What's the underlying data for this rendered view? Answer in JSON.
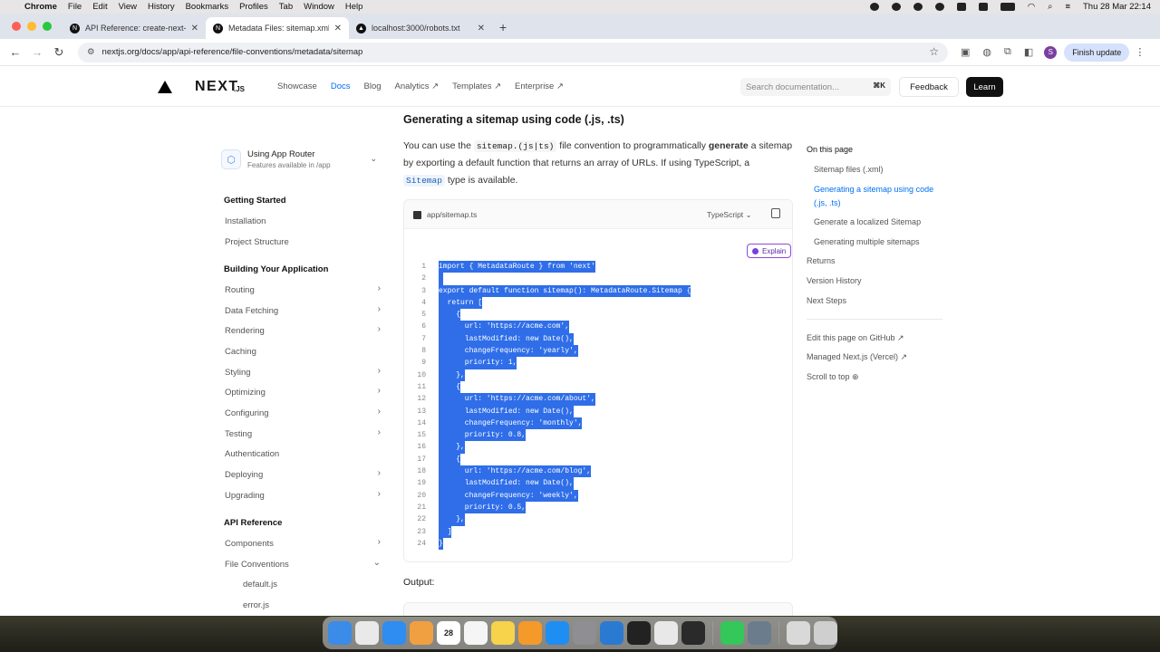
{
  "menubar": {
    "apple": "",
    "app": "Chrome",
    "items": [
      "File",
      "Edit",
      "View",
      "History",
      "Bookmarks",
      "Profiles",
      "Tab",
      "Window",
      "Help"
    ],
    "datetime": "Thu 28 Mar  22:14"
  },
  "tabs": [
    {
      "title": "API Reference: create-next-a",
      "icon": "N",
      "active": false
    },
    {
      "title": "Metadata Files: sitemap.xml |",
      "icon": "N",
      "active": true
    },
    {
      "title": "localhost:3000/robots.txt",
      "icon": "▲",
      "active": false
    }
  ],
  "address": {
    "url": "nextjs.org/docs/app/api-reference/file-conventions/metadata/sitemap",
    "profile_initial": "S",
    "finish_update": "Finish update"
  },
  "site_header": {
    "logo_text": "NEXT",
    "logo_suffix": ".JS",
    "nav": [
      "Showcase",
      "Docs",
      "Blog",
      "Analytics ↗",
      "Templates ↗",
      "Enterprise ↗"
    ],
    "search_placeholder": "Search documentation...",
    "search_kbd": "⌘K",
    "feedback": "Feedback",
    "learn": "Learn"
  },
  "router_selector": {
    "title": "Using App Router",
    "subtitle": "Features available in /app"
  },
  "sidebar": {
    "sections": [
      {
        "heading": "Getting Started",
        "items": [
          {
            "label": "Installation",
            "chevron": false
          },
          {
            "label": "Project Structure",
            "chevron": false
          }
        ]
      },
      {
        "heading": "Building Your Application",
        "items": [
          {
            "label": "Routing",
            "chevron": true
          },
          {
            "label": "Data Fetching",
            "chevron": true
          },
          {
            "label": "Rendering",
            "chevron": true
          },
          {
            "label": "Caching",
            "chevron": false
          },
          {
            "label": "Styling",
            "chevron": true
          },
          {
            "label": "Optimizing",
            "chevron": true
          },
          {
            "label": "Configuring",
            "chevron": true
          },
          {
            "label": "Testing",
            "chevron": true
          },
          {
            "label": "Authentication",
            "chevron": false
          },
          {
            "label": "Deploying",
            "chevron": true
          },
          {
            "label": "Upgrading",
            "chevron": true
          }
        ]
      },
      {
        "heading": "API Reference",
        "items": [
          {
            "label": "Components",
            "chevron": true
          },
          {
            "label": "File Conventions",
            "chevron": true
          }
        ]
      }
    ],
    "sub_items": [
      "default.js",
      "error.js"
    ]
  },
  "article": {
    "heading": "Generating a sitemap using code (.js, .ts)",
    "p_before_code": "You can use the",
    "code1": "sitemap.(js|ts)",
    "p_mid1": "file convention to programmatically",
    "bold": "generate",
    "p_mid2": "a sitemap by exporting a default function that returns an array of URLs. If using TypeScript, a",
    "code2": "Sitemap",
    "p_after": "type is available.",
    "output_label": "Output:"
  },
  "code_block": {
    "filename": "app/sitemap.ts",
    "language": "TypeScript",
    "explain": "Explain",
    "lines": [
      "import { MetadataRoute } from 'next'",
      " ",
      "export default function sitemap(): MetadataRoute.Sitemap {",
      "  return [",
      "    {",
      "      url: 'https://acme.com',",
      "      lastModified: new Date(),",
      "      changeFrequency: 'yearly',",
      "      priority: 1,",
      "    },",
      "    {",
      "      url: 'https://acme.com/about',",
      "      lastModified: new Date(),",
      "      changeFrequency: 'monthly',",
      "      priority: 0.8,",
      "    },",
      "    {",
      "      url: 'https://acme.com/blog',",
      "      lastModified: new Date(),",
      "      changeFrequency: 'weekly',",
      "      priority: 0.5,",
      "    },",
      "  ]",
      "}"
    ]
  },
  "toc": {
    "heading": "On this page",
    "items": [
      {
        "label": "Sitemap files (.xml)",
        "active": false,
        "indent": true
      },
      {
        "label": "Generating a sitemap using code (.js, .ts)",
        "active": true,
        "indent": true
      },
      {
        "label": "Generate a localized Sitemap",
        "active": false,
        "indent": true
      },
      {
        "label": "Generating multiple sitemaps",
        "active": false,
        "indent": true
      },
      {
        "label": "Returns",
        "active": false,
        "indent": false
      },
      {
        "label": "Version History",
        "active": false,
        "indent": false
      },
      {
        "label": "Next Steps",
        "active": false,
        "indent": false
      }
    ],
    "links": [
      "Edit this page on GitHub ↗",
      "Managed Next.js (Vercel) ↗",
      "Scroll to top ⊕"
    ]
  },
  "dock": {
    "apps": [
      {
        "name": "finder-icon",
        "color": "#3b8be8"
      },
      {
        "name": "launchpad-icon",
        "color": "#e9e9e9"
      },
      {
        "name": "safari-icon",
        "color": "#2f8cf0"
      },
      {
        "name": "photos-icon",
        "color": "#f0a040"
      },
      {
        "name": "calendar-icon",
        "color": "#ffffff",
        "text": "28"
      },
      {
        "name": "reminders-icon",
        "color": "#f5f5f5"
      },
      {
        "name": "notes-icon",
        "color": "#f7d24b"
      },
      {
        "name": "pages-icon",
        "color": "#f39a2a"
      },
      {
        "name": "app-store-icon",
        "color": "#1e8ef3"
      },
      {
        "name": "system-settings-icon",
        "color": "#8e8e93"
      },
      {
        "name": "vscode-icon",
        "color": "#2a7ad2"
      },
      {
        "name": "terminal-icon",
        "color": "#222222"
      },
      {
        "name": "chrome-icon",
        "color": "#e8e8e8"
      },
      {
        "name": "activity-monitor-icon",
        "color": "#2a2a2a"
      },
      {
        "name": "numbers-icon",
        "color": "#34c759"
      },
      {
        "name": "disk-utility-icon",
        "color": "#6b7d8c"
      },
      {
        "name": "documents-folder-icon",
        "color": "#d9d9d9"
      },
      {
        "name": "trash-icon",
        "color": "#cfcfcf"
      }
    ]
  },
  "colors": {
    "accent": "#0070f3",
    "selection": "#2f6ee8",
    "explain_border": "#8b4cd6"
  }
}
